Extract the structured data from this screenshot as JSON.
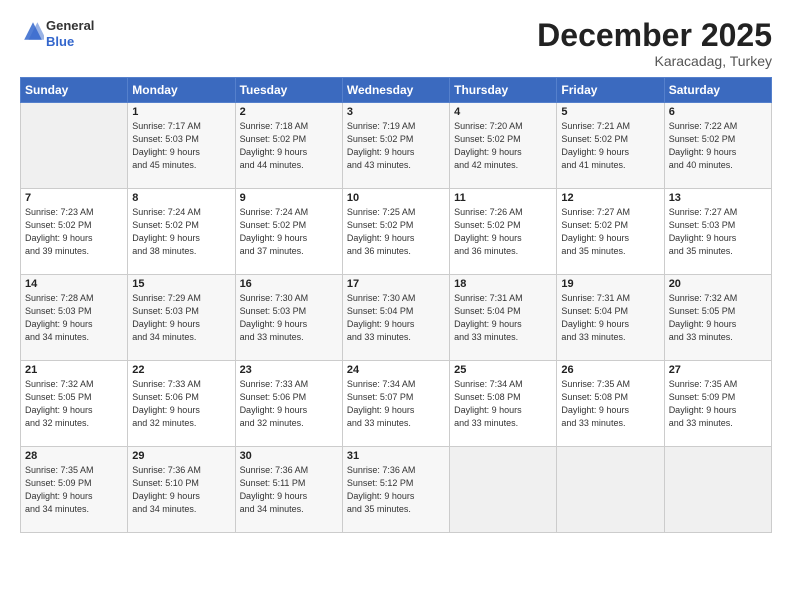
{
  "header": {
    "logo_general": "General",
    "logo_blue": "Blue",
    "month": "December 2025",
    "location": "Karacadag, Turkey"
  },
  "weekdays": [
    "Sunday",
    "Monday",
    "Tuesday",
    "Wednesday",
    "Thursday",
    "Friday",
    "Saturday"
  ],
  "weeks": [
    [
      {
        "day": "",
        "info": ""
      },
      {
        "day": "1",
        "info": "Sunrise: 7:17 AM\nSunset: 5:03 PM\nDaylight: 9 hours\nand 45 minutes."
      },
      {
        "day": "2",
        "info": "Sunrise: 7:18 AM\nSunset: 5:02 PM\nDaylight: 9 hours\nand 44 minutes."
      },
      {
        "day": "3",
        "info": "Sunrise: 7:19 AM\nSunset: 5:02 PM\nDaylight: 9 hours\nand 43 minutes."
      },
      {
        "day": "4",
        "info": "Sunrise: 7:20 AM\nSunset: 5:02 PM\nDaylight: 9 hours\nand 42 minutes."
      },
      {
        "day": "5",
        "info": "Sunrise: 7:21 AM\nSunset: 5:02 PM\nDaylight: 9 hours\nand 41 minutes."
      },
      {
        "day": "6",
        "info": "Sunrise: 7:22 AM\nSunset: 5:02 PM\nDaylight: 9 hours\nand 40 minutes."
      }
    ],
    [
      {
        "day": "7",
        "info": "Sunrise: 7:23 AM\nSunset: 5:02 PM\nDaylight: 9 hours\nand 39 minutes."
      },
      {
        "day": "8",
        "info": "Sunrise: 7:24 AM\nSunset: 5:02 PM\nDaylight: 9 hours\nand 38 minutes."
      },
      {
        "day": "9",
        "info": "Sunrise: 7:24 AM\nSunset: 5:02 PM\nDaylight: 9 hours\nand 37 minutes."
      },
      {
        "day": "10",
        "info": "Sunrise: 7:25 AM\nSunset: 5:02 PM\nDaylight: 9 hours\nand 36 minutes."
      },
      {
        "day": "11",
        "info": "Sunrise: 7:26 AM\nSunset: 5:02 PM\nDaylight: 9 hours\nand 36 minutes."
      },
      {
        "day": "12",
        "info": "Sunrise: 7:27 AM\nSunset: 5:02 PM\nDaylight: 9 hours\nand 35 minutes."
      },
      {
        "day": "13",
        "info": "Sunrise: 7:27 AM\nSunset: 5:03 PM\nDaylight: 9 hours\nand 35 minutes."
      }
    ],
    [
      {
        "day": "14",
        "info": "Sunrise: 7:28 AM\nSunset: 5:03 PM\nDaylight: 9 hours\nand 34 minutes."
      },
      {
        "day": "15",
        "info": "Sunrise: 7:29 AM\nSunset: 5:03 PM\nDaylight: 9 hours\nand 34 minutes."
      },
      {
        "day": "16",
        "info": "Sunrise: 7:30 AM\nSunset: 5:03 PM\nDaylight: 9 hours\nand 33 minutes."
      },
      {
        "day": "17",
        "info": "Sunrise: 7:30 AM\nSunset: 5:04 PM\nDaylight: 9 hours\nand 33 minutes."
      },
      {
        "day": "18",
        "info": "Sunrise: 7:31 AM\nSunset: 5:04 PM\nDaylight: 9 hours\nand 33 minutes."
      },
      {
        "day": "19",
        "info": "Sunrise: 7:31 AM\nSunset: 5:04 PM\nDaylight: 9 hours\nand 33 minutes."
      },
      {
        "day": "20",
        "info": "Sunrise: 7:32 AM\nSunset: 5:05 PM\nDaylight: 9 hours\nand 33 minutes."
      }
    ],
    [
      {
        "day": "21",
        "info": "Sunrise: 7:32 AM\nSunset: 5:05 PM\nDaylight: 9 hours\nand 32 minutes."
      },
      {
        "day": "22",
        "info": "Sunrise: 7:33 AM\nSunset: 5:06 PM\nDaylight: 9 hours\nand 32 minutes."
      },
      {
        "day": "23",
        "info": "Sunrise: 7:33 AM\nSunset: 5:06 PM\nDaylight: 9 hours\nand 32 minutes."
      },
      {
        "day": "24",
        "info": "Sunrise: 7:34 AM\nSunset: 5:07 PM\nDaylight: 9 hours\nand 33 minutes."
      },
      {
        "day": "25",
        "info": "Sunrise: 7:34 AM\nSunset: 5:08 PM\nDaylight: 9 hours\nand 33 minutes."
      },
      {
        "day": "26",
        "info": "Sunrise: 7:35 AM\nSunset: 5:08 PM\nDaylight: 9 hours\nand 33 minutes."
      },
      {
        "day": "27",
        "info": "Sunrise: 7:35 AM\nSunset: 5:09 PM\nDaylight: 9 hours\nand 33 minutes."
      }
    ],
    [
      {
        "day": "28",
        "info": "Sunrise: 7:35 AM\nSunset: 5:09 PM\nDaylight: 9 hours\nand 34 minutes."
      },
      {
        "day": "29",
        "info": "Sunrise: 7:36 AM\nSunset: 5:10 PM\nDaylight: 9 hours\nand 34 minutes."
      },
      {
        "day": "30",
        "info": "Sunrise: 7:36 AM\nSunset: 5:11 PM\nDaylight: 9 hours\nand 34 minutes."
      },
      {
        "day": "31",
        "info": "Sunrise: 7:36 AM\nSunset: 5:12 PM\nDaylight: 9 hours\nand 35 minutes."
      },
      {
        "day": "",
        "info": ""
      },
      {
        "day": "",
        "info": ""
      },
      {
        "day": "",
        "info": ""
      }
    ]
  ]
}
